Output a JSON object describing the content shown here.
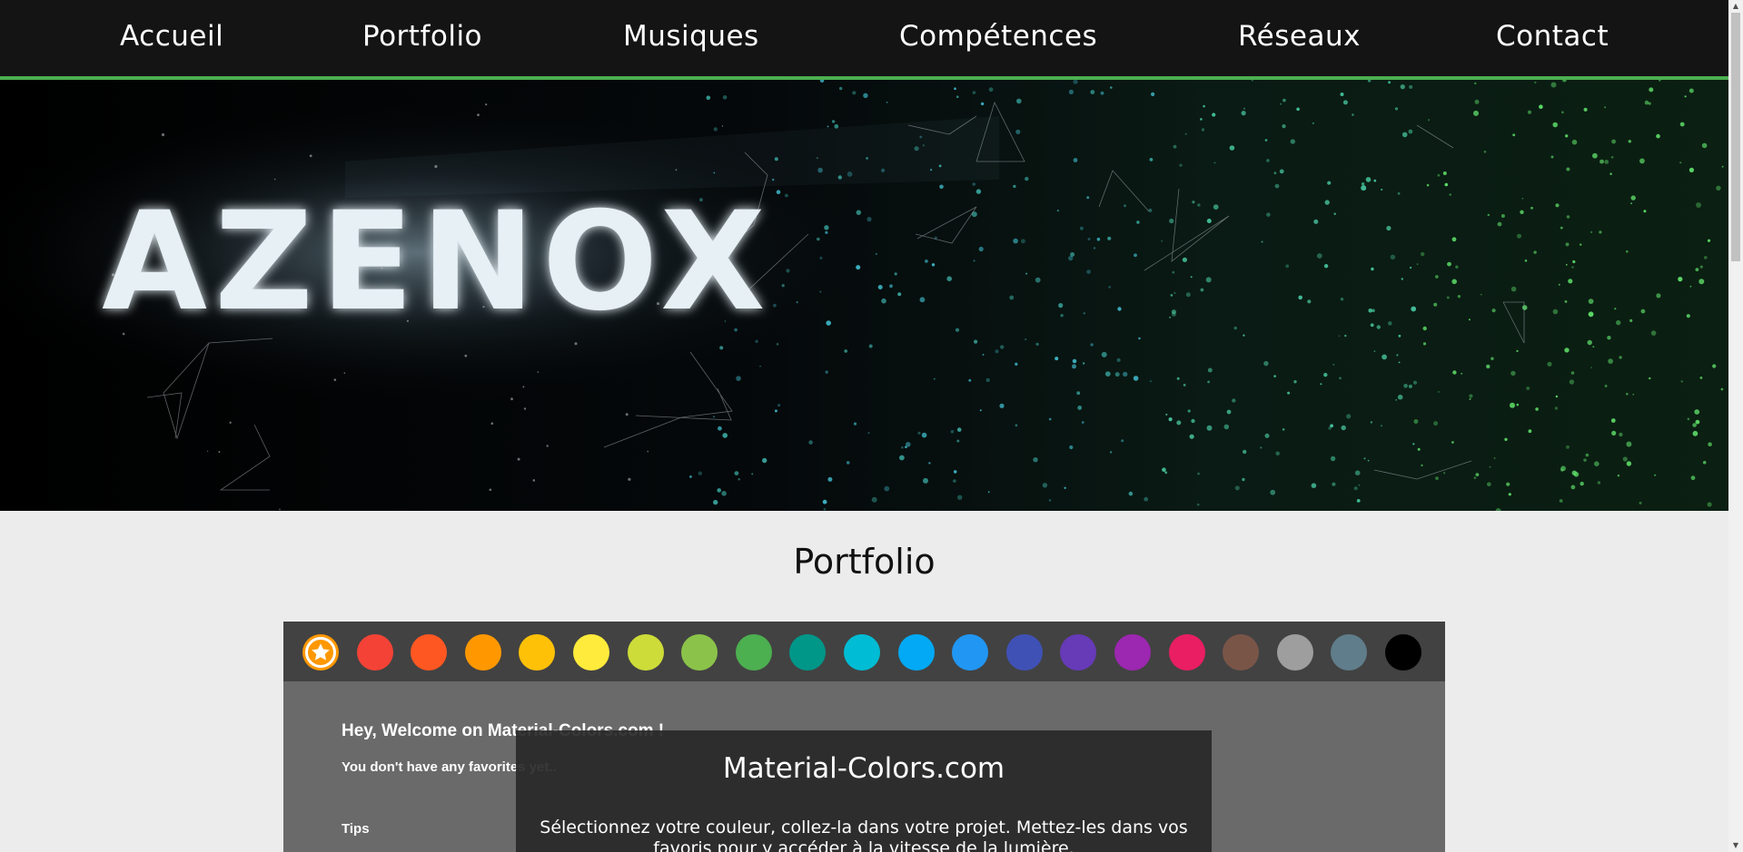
{
  "nav": {
    "items": [
      {
        "label": "Accueil"
      },
      {
        "label": "Portfolio"
      },
      {
        "label": "Musiques"
      },
      {
        "label": "Compétences"
      },
      {
        "label": "Réseaux"
      },
      {
        "label": "Contact"
      }
    ],
    "accent_color": "#4caf50"
  },
  "banner": {
    "logo_text": "AZENOX"
  },
  "portfolio": {
    "title": "Portfolio",
    "swatches": [
      {
        "name": "favorites",
        "color": "#ff9800",
        "icon": "star-icon"
      },
      {
        "name": "red",
        "color": "#f44336"
      },
      {
        "name": "deep-orange",
        "color": "#ff5722"
      },
      {
        "name": "orange",
        "color": "#ff9800"
      },
      {
        "name": "amber",
        "color": "#ffc107"
      },
      {
        "name": "yellow",
        "color": "#ffeb3b"
      },
      {
        "name": "lime",
        "color": "#cddc39"
      },
      {
        "name": "light-green",
        "color": "#8bc34a"
      },
      {
        "name": "green",
        "color": "#4caf50"
      },
      {
        "name": "teal",
        "color": "#009688"
      },
      {
        "name": "cyan",
        "color": "#00bcd4"
      },
      {
        "name": "light-blue",
        "color": "#03a9f4"
      },
      {
        "name": "blue",
        "color": "#2196f3"
      },
      {
        "name": "indigo",
        "color": "#3f51b5"
      },
      {
        "name": "deep-purple",
        "color": "#673ab7"
      },
      {
        "name": "purple",
        "color": "#9c27b0"
      },
      {
        "name": "pink",
        "color": "#e91e63"
      },
      {
        "name": "brown",
        "color": "#795548"
      },
      {
        "name": "grey",
        "color": "#9e9e9e"
      },
      {
        "name": "blue-grey",
        "color": "#607d8b"
      },
      {
        "name": "black",
        "color": "#000000"
      }
    ],
    "welcome_heading": "Hey, Welcome on Material-Colors.com !",
    "favorites_empty": "You don't have any favorites yet..",
    "tips_label": "Tips",
    "overlay": {
      "title": "Material-Colors.com",
      "description": "Sélectionnez votre couleur, collez-la dans votre projet. Mettez-les dans vos favoris pour y accéder à la vitesse de la lumière."
    }
  }
}
